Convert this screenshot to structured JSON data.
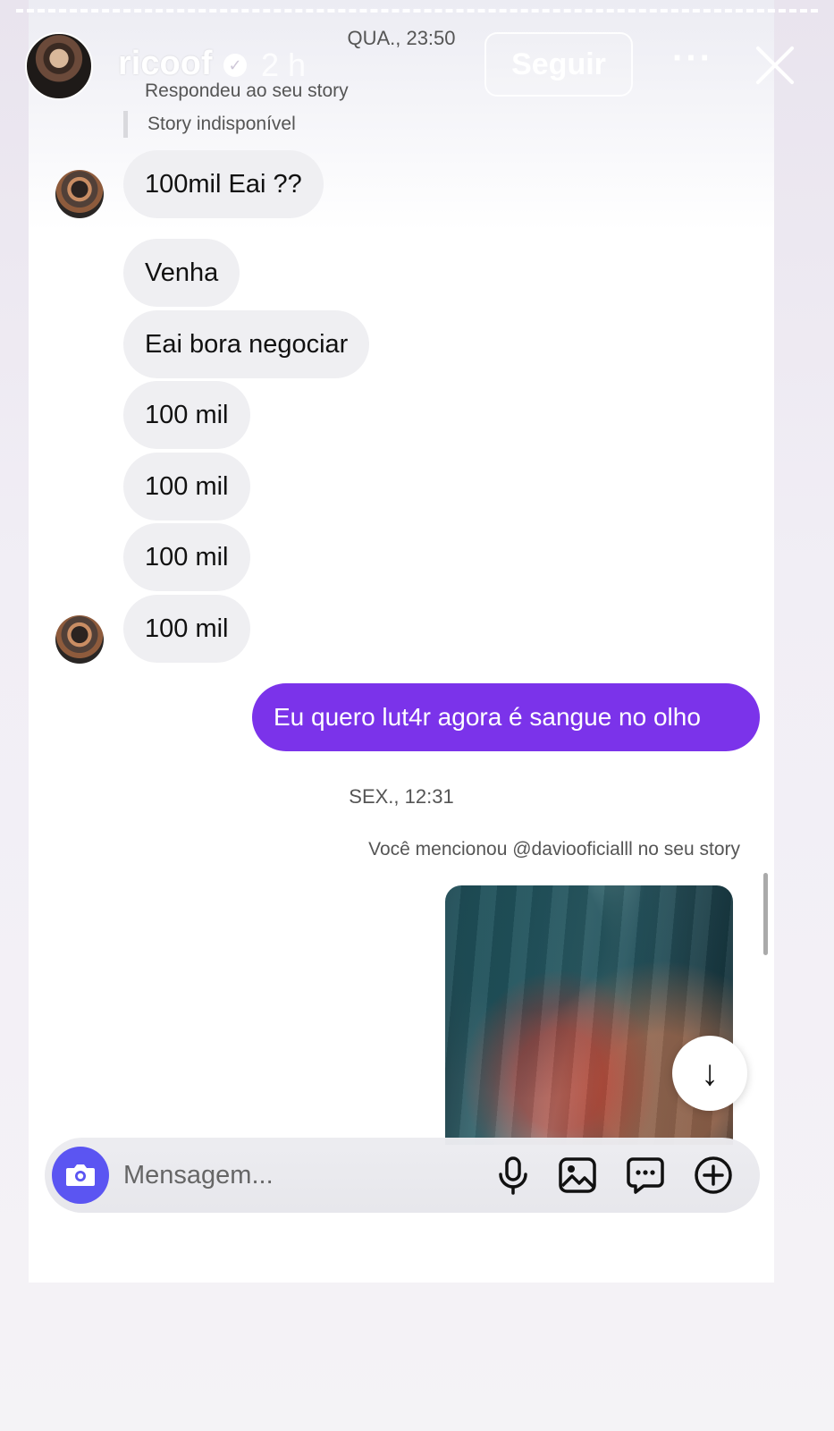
{
  "story": {
    "username": "ricoof",
    "age": "2 h",
    "follow_label": "Seguir",
    "more_label": "···"
  },
  "chat": {
    "top_timestamp": "QUA., 23:50",
    "reply_label": "Respondeu ao seu story",
    "story_quote": "Story indisponível",
    "incoming": [
      "100mil Eai ??",
      "Venha",
      "Eai bora negociar",
      "100 mil",
      "100 mil",
      "100 mil",
      "100 mil"
    ],
    "outgoing": "Eu quero lut4r agora é sangue no olho",
    "separator_time": "SEX., 12:31",
    "mention_note": "Você mencionou @daviooficialll no seu story"
  },
  "composer": {
    "placeholder": "Mensagem..."
  },
  "colors": {
    "accent_outgoing": "#7b33ea",
    "camera_button": "#5b55f2",
    "incoming_bubble": "#efeff2"
  },
  "icons": {
    "camera": "camera-icon",
    "mic": "microphone-icon",
    "gallery": "image-icon",
    "sticker": "chat-bubble-icon",
    "plus": "plus-circle-icon",
    "scroll_down": "arrow-down-icon",
    "close": "close-icon",
    "verified": "verified-badge-icon"
  }
}
